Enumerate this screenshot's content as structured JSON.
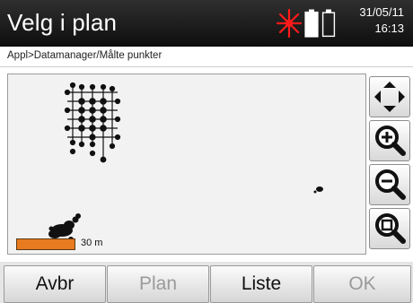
{
  "header": {
    "title": "Velg i plan",
    "date": "31/05/11",
    "time": "16:13",
    "icons": [
      "laser-icon",
      "battery-icon",
      "battery-icon"
    ]
  },
  "breadcrumb": "Appl>Datamanager/Målte punkter",
  "map": {
    "scale_label": "30 m",
    "scale_bar_color": "#e87a1f"
  },
  "side_toolbar": [
    "pan-icon",
    "zoom-in-icon",
    "zoom-out-icon",
    "zoom-fit-icon"
  ],
  "softkeys": [
    {
      "label": "Avbr",
      "enabled": true
    },
    {
      "label": "Plan",
      "enabled": false
    },
    {
      "label": "Liste",
      "enabled": true
    },
    {
      "label": "OK",
      "enabled": false
    }
  ]
}
